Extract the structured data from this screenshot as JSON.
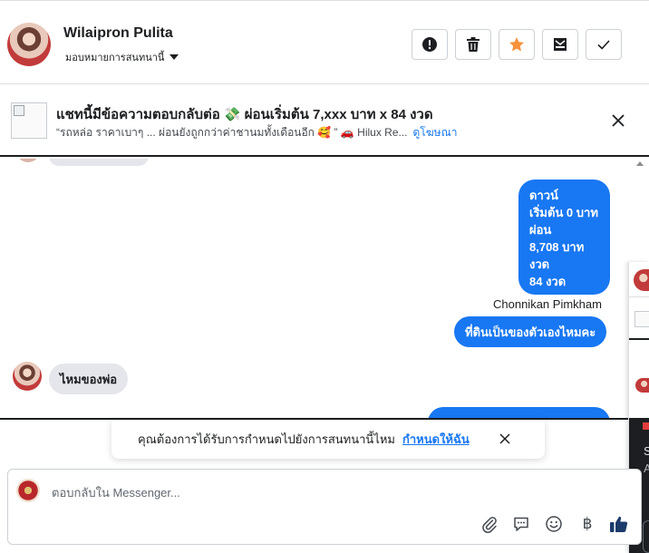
{
  "header": {
    "name": "Wilaipron Pulita",
    "assign_label": "มอบหมายการสนทนานี้",
    "buttons": [
      {
        "name": "report",
        "icon": "alert-icon"
      },
      {
        "name": "delete",
        "icon": "trash-icon"
      },
      {
        "name": "star",
        "icon": "star-icon",
        "color": "#f7923b"
      },
      {
        "name": "spam",
        "icon": "spam-icon"
      },
      {
        "name": "done",
        "icon": "check-icon"
      }
    ]
  },
  "ad": {
    "title": "แชทนี้มีข้อความตอบกลับต่อ 💸 ผ่อนเริ่มต้น 7,xxx บาท x 84 งวด",
    "subtitle": "“รถหล่อ ราคาเบาๆ ... ผ่อนยังถูกกว่าค่าชานมทั้งเดือนอีก 🥰 ” 🚗 Hilux Re...",
    "link": "ดูโฆษณา"
  },
  "messages": {
    "long_bubble_lines": [
      "ดาวน์",
      "เริ่มต้น 0 บาท",
      "ผ่อน",
      "8,708 บาท",
      "งวด",
      "84 งวด"
    ],
    "sender": "Chonnikan Pimkham",
    "outgoing_short": "ที่ดินเป็นของตัวเองไหมคะ",
    "incoming": "ไหมของพ่อ"
  },
  "side_panel": {
    "line1": "S",
    "line2": "A"
  },
  "toast": {
    "text": "คุณต้องการได้รับการกำหนดไปยังการสนทนานี้ไหม",
    "link": "กำหนดให้ฉัน"
  },
  "composer": {
    "placeholder": "ตอบกลับใน Messenger...",
    "currency_symbol": "฿"
  },
  "colors": {
    "accent": "#1877f2",
    "incoming_bubble": "#e4e6eb",
    "star": "#f7923b"
  }
}
